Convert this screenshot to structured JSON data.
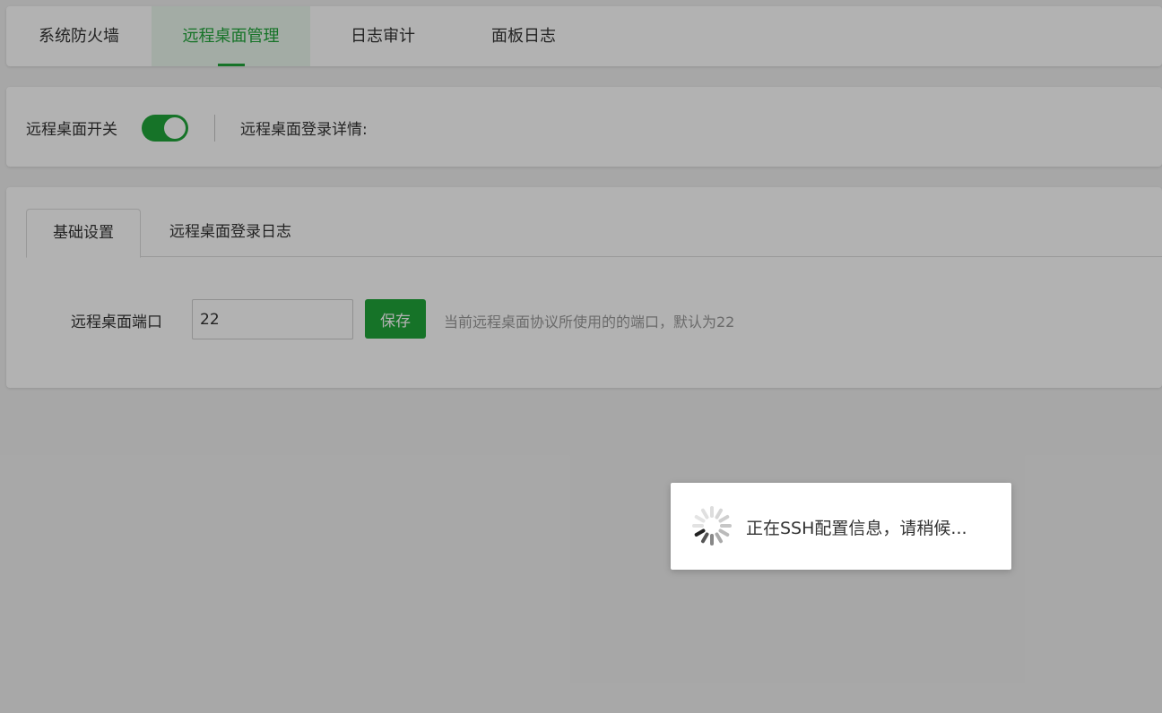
{
  "top_tabs": [
    {
      "label": "系统防火墙"
    },
    {
      "label": "远程桌面管理"
    },
    {
      "label": "日志审计"
    },
    {
      "label": "面板日志"
    }
  ],
  "switch_row": {
    "label": "远程桌面开关",
    "enabled": true,
    "detail_label": "远程桌面登录详情:"
  },
  "settings": {
    "tabs": [
      {
        "label": "基础设置"
      },
      {
        "label": "远程桌面登录日志"
      }
    ],
    "port_label": "远程桌面端口",
    "port_value": "22",
    "save_label": "保存",
    "hint": "当前远程桌面协议所使用的的端口，默认为22"
  },
  "loading": {
    "text": "正在SSH配置信息，请稍候..."
  },
  "colors": {
    "accent": "#20a53a",
    "text": "#333333",
    "muted": "#999999"
  }
}
